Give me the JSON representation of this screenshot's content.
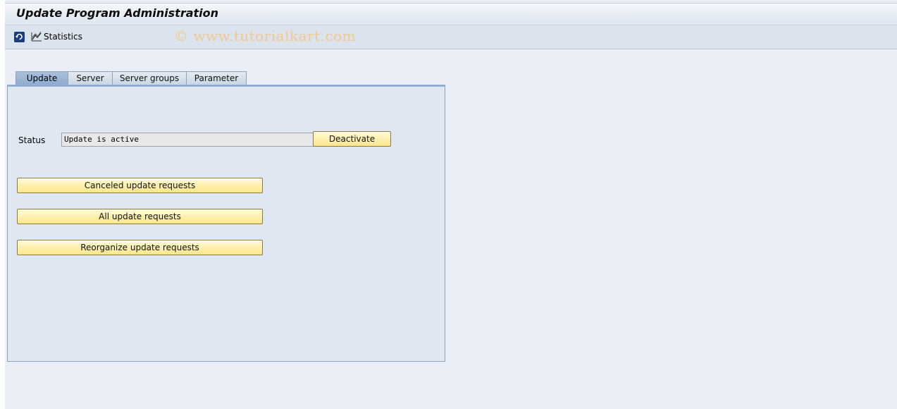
{
  "window": {
    "title": "Update Program Administration"
  },
  "toolbar": {
    "refresh_icon": "refresh-icon",
    "statistics_icon": "statistics-chart-icon",
    "statistics_label": "Statistics"
  },
  "watermark": "© www.tutorialkart.com",
  "tabs": [
    {
      "label": "Update",
      "active": true
    },
    {
      "label": "Server",
      "active": false
    },
    {
      "label": "Server groups",
      "active": false
    },
    {
      "label": "Parameter",
      "active": false
    }
  ],
  "update_tab": {
    "status_label": "Status",
    "status_value": "Update is active",
    "deactivate_label": "Deactivate",
    "canceled_requests_label": "Canceled update requests",
    "all_requests_label": "All update requests",
    "reorganize_label": "Reorganize update requests"
  },
  "colors": {
    "button_fill": "#fbe68a",
    "active_tab": "#8eabd0",
    "panel": "#dfe8f2"
  }
}
